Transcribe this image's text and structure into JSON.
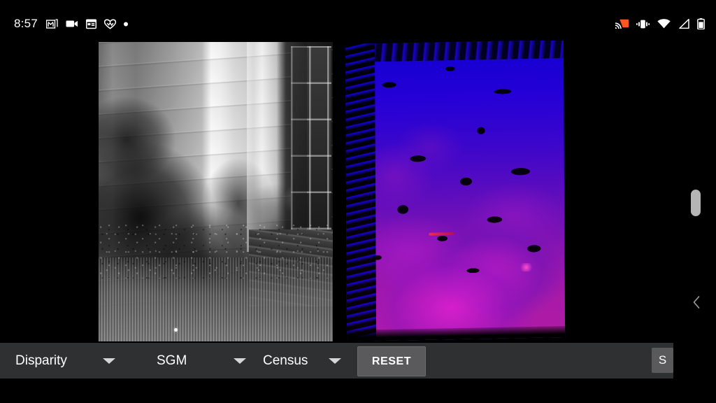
{
  "status_bar": {
    "clock": "8:57",
    "left_icons": [
      {
        "name": "gmail-icon",
        "glyph": "M"
      },
      {
        "name": "video-camera-icon",
        "glyph": "▶"
      },
      {
        "name": "calendar-icon",
        "glyph": "▦"
      },
      {
        "name": "heart-fit-icon",
        "glyph": "♥"
      },
      {
        "name": "more-notifications-dot-icon",
        "glyph": "•"
      }
    ],
    "right_icons": [
      {
        "name": "cast-icon",
        "color": "#ff5722"
      },
      {
        "name": "vibrate-icon",
        "color": "#ffffff"
      },
      {
        "name": "wifi-icon",
        "color": "#ffffff"
      },
      {
        "name": "cell-signal-icon",
        "color": "#ffffff"
      },
      {
        "name": "battery-icon",
        "color": "#ffffff"
      }
    ]
  },
  "viewer": {
    "left_image": {
      "label": "rectified-grayscale-frame",
      "description": "Grayscale stereo reference frame: backyard flowerpots scene with house siding, door and deck"
    },
    "right_image": {
      "label": "disparity-colormap",
      "description": "Computed disparity map rendered with a blue-to-magenta depth colormap; black regions are unmatched/occluded pixels",
      "near_color": "#c81ec8",
      "far_color": "#1200cf",
      "invalid_color": "#000000"
    }
  },
  "toolbar": {
    "dropdowns": [
      {
        "id": "mode",
        "label": "Disparity",
        "name": "output-mode-dropdown"
      },
      {
        "id": "algorithm",
        "label": "SGM",
        "name": "algorithm-dropdown"
      },
      {
        "id": "cost",
        "label": "Census",
        "name": "cost-function-dropdown"
      }
    ],
    "reset_label": "RESET",
    "s_label": "S",
    "background": "#2f3032",
    "button_background": "#5a5a5c"
  },
  "nav": {
    "back_chevron": "‹",
    "scrollbar": {
      "name": "vertical-scrollbar-thumb",
      "color": "#b5b5b5"
    }
  }
}
